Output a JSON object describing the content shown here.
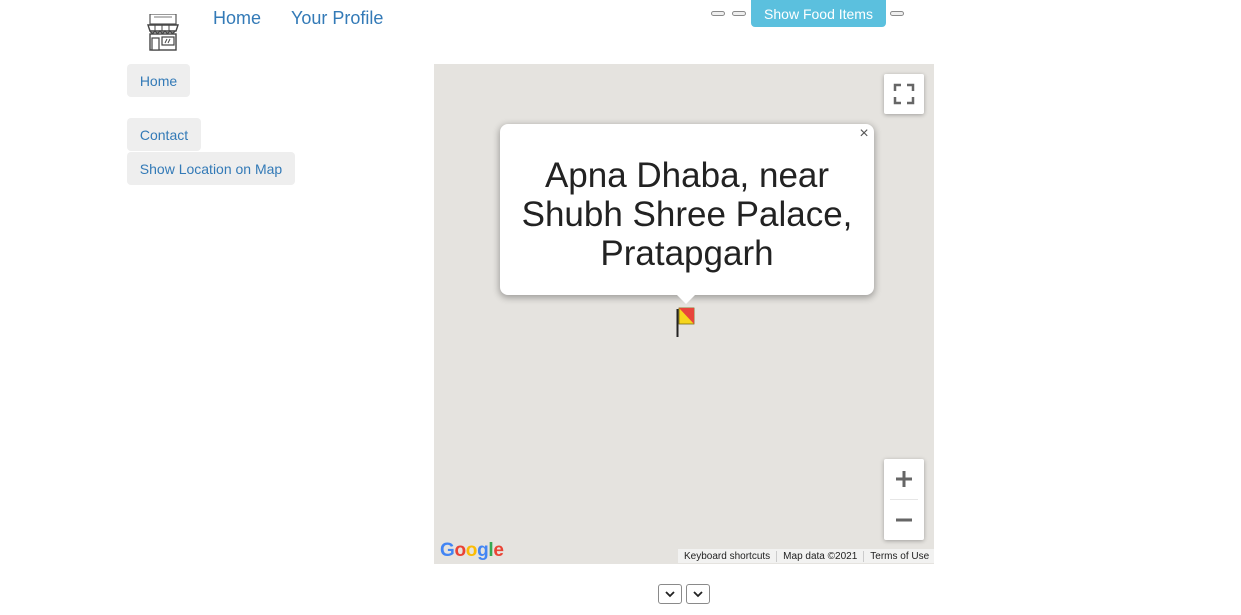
{
  "header": {
    "logo_icon": "storefront-icon",
    "nav": [
      {
        "label": "Home"
      },
      {
        "label": "Your Profile"
      }
    ],
    "show_food_items_label": "Show Food Items",
    "button_color": "#5bc0de",
    "link_color": "#337ab7"
  },
  "sidebar": {
    "items": [
      {
        "label": "Home"
      },
      {
        "label": "Contact"
      },
      {
        "label": "Show Location on Map"
      }
    ]
  },
  "map": {
    "background_color": "#e5e3df",
    "info_window": {
      "line1": "Apna Dhaba, near",
      "line2": "Shubh Shree Palace,",
      "line3": "Pratapgarh",
      "close_glyph": "×"
    },
    "marker_icon": "flag-marker-icon",
    "logo_text": "Google",
    "attribution": {
      "shortcuts": "Keyboard shortcuts",
      "data": "Map data ©2021",
      "terms": "Terms of Use"
    },
    "controls": {
      "fullscreen_icon": "fullscreen-icon",
      "zoom_in_icon": "plus-icon",
      "zoom_out_icon": "minus-icon"
    }
  },
  "footer": {
    "select_icons": [
      "chevron-down-icon",
      "chevron-down-icon"
    ]
  }
}
